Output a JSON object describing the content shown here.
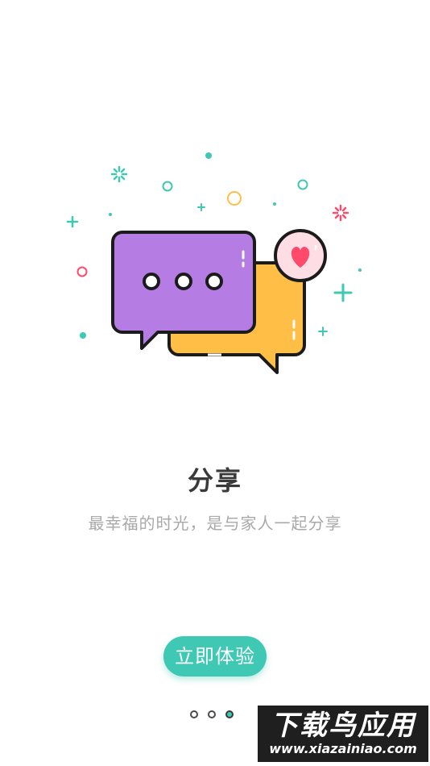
{
  "onboarding": {
    "title": "分享",
    "subtitle": "最幸福的时光，是与家人一起分享",
    "cta_label": "立即体验"
  },
  "pager": {
    "total_pages": 3,
    "current_page": 3
  },
  "illustration": {
    "icon": "chat-bubbles-icon",
    "badge_icon": "heart-icon"
  },
  "watermark": {
    "brand": "下载鸟应用",
    "url": "www.xiazainiao.com"
  },
  "colors": {
    "accent": "#3fc8b3",
    "purple_bubble": "#b57de3",
    "yellow_bubble": "#ffbf47",
    "heart": "#ff4a6b",
    "title_text": "#3a3a3a",
    "subtitle_text": "#a9a9a9"
  }
}
